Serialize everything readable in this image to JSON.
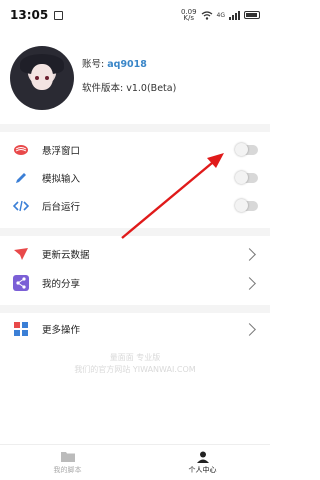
{
  "status_bar": {
    "time": "13:05",
    "network_speed": "0.09\nK/s",
    "network_type": "4G"
  },
  "profile": {
    "account_label": "账号:",
    "account_value": "aq9018",
    "version_label": "软件版本:",
    "version_value": "v1.0(Beta)"
  },
  "settings": [
    {
      "label": "悬浮窗口",
      "icon": "float-window-icon",
      "color": "#e8494a",
      "state": false
    },
    {
      "label": "模拟输入",
      "icon": "pencil-icon",
      "color": "#3b7fd6",
      "state": false
    },
    {
      "label": "后台运行",
      "icon": "code-icon",
      "color": "#3b7fd6",
      "state": false
    }
  ],
  "actions": [
    {
      "label": "更新云数据",
      "icon": "paper-plane-icon",
      "color": "#e8494a"
    },
    {
      "label": "我的分享",
      "icon": "share-icon",
      "color": "#7b5fd6"
    }
  ],
  "more": {
    "label": "更多操作",
    "icon": "grid-icon",
    "color": "#3b7fd6"
  },
  "watermark": {
    "line1": "量面面 专业版",
    "line2": "我们的官方网站 YIWANWAI.COM"
  },
  "bottom_nav": {
    "tab1_label": "我的脚本",
    "tab2_label": "个人中心"
  },
  "colors": {
    "accent_blue": "#3a86c8",
    "annotation_red": "#e01a1a"
  }
}
